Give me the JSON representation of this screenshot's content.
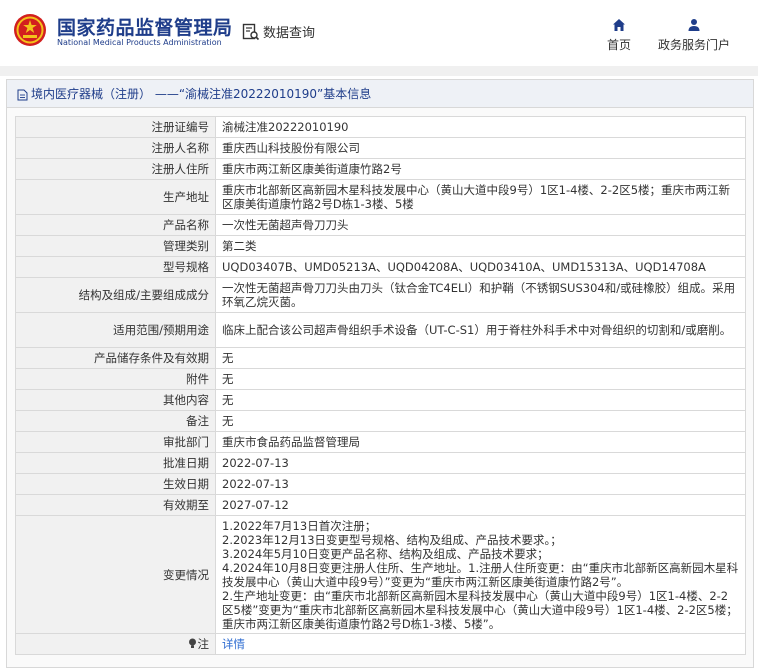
{
  "header": {
    "brand_cn": "国家药品监督管理局",
    "brand_en": "National Medical Products Administration",
    "query_label": "数据查询",
    "nav": {
      "home": "首页",
      "gov": "政务服务门户"
    }
  },
  "colors": {
    "brand": "#1f3d8a",
    "link": "#2e6cd1",
    "emblem_red": "#d21f1f",
    "emblem_gold": "#f3c21b"
  },
  "panel": {
    "title": "境内医疗器械（注册） ——“渝械注准20222010190”基本信息"
  },
  "rows": [
    {
      "label": "注册证编号",
      "value": "渝械注准20222010190"
    },
    {
      "label": "注册人名称",
      "value": "重庆西山科技股份有限公司"
    },
    {
      "label": "注册人住所",
      "value": "重庆市两江新区康美街道康竹路2号"
    },
    {
      "label": "生产地址",
      "value": "重庆市北部新区高新园木星科技发展中心（黄山大道中段9号）1区1-4楼、2-2区5楼；重庆市两江新区康美街道康竹路2号D栋1-3楼、5楼"
    },
    {
      "label": "产品名称",
      "value": "一次性无菌超声骨刀刀头"
    },
    {
      "label": "管理类别",
      "value": "第二类"
    },
    {
      "label": "型号规格",
      "value": "UQD03407B、UMD05213A、UQD04208A、UQD03410A、UMD15313A、UQD14708A"
    },
    {
      "label": "结构及组成/主要组成成分",
      "value": "一次性无菌超声骨刀刀头由刀头（钛合金TC4ELI）和护鞘（不锈钢SUS304和/或硅橡胶）组成。采用环氧乙烷灭菌。"
    },
    {
      "label": "适用范围/预期用途",
      "value": "临床上配合该公司超声骨组织手术设备（UT-C-S1）用于脊柱外科手术中对骨组织的切割和/或磨削。"
    },
    {
      "label": "产品储存条件及有效期",
      "value": "无"
    },
    {
      "label": "附件",
      "value": "无"
    },
    {
      "label": "其他内容",
      "value": "无"
    },
    {
      "label": "备注",
      "value": "无"
    },
    {
      "label": "审批部门",
      "value": "重庆市食品药品监督管理局"
    },
    {
      "label": "批准日期",
      "value": "2022-07-13"
    },
    {
      "label": "生效日期",
      "value": "2022-07-13"
    },
    {
      "label": "有效期至",
      "value": "2027-07-12"
    },
    {
      "label": "变更情况",
      "value": "1.2022年7月13日首次注册；\n2.2023年12月13日变更型号规格、结构及组成、产品技术要求。；\n3.2024年5月10日变更产品名称、结构及组成、产品技术要求；\n4.2024年10月8日变更注册人住所、生产地址。1.注册人住所变更：由“重庆市北部新区高新园木星科技发展中心（黄山大道中段9号）”变更为“重庆市两江新区康美街道康竹路2号”。\n2.生产地址变更：由“重庆市北部新区高新园木星科技发展中心（黄山大道中段9号）1区1-4楼、2-2区5楼”变更为“重庆市北部新区高新园木星科技发展中心（黄山大道中段9号）1区1-4楼、2-2区5楼；重庆市两江新区康美街道康竹路2号D栋1-3楼、5楼”。"
    }
  ],
  "note": {
    "label": "注",
    "link": "详情"
  }
}
